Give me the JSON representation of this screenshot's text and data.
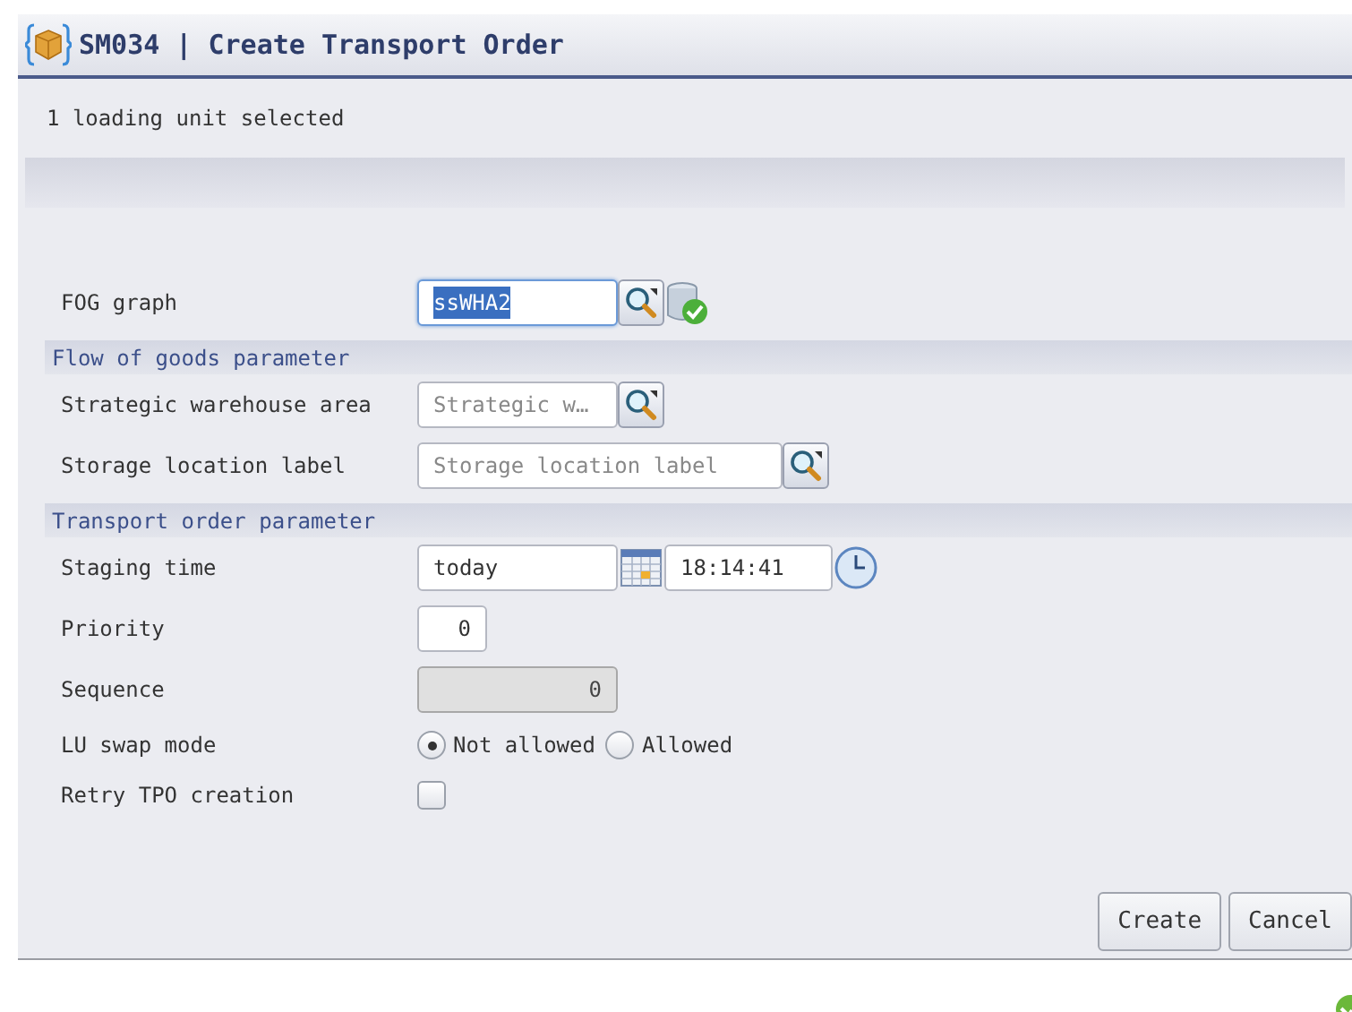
{
  "window": {
    "title": "SM034 | Create Transport Order"
  },
  "info": "1 loading unit selected",
  "rows": [
    {
      "kind": "field",
      "label": "FOG graph",
      "value": "ssWHA2",
      "focused": true,
      "validated": true
    },
    {
      "kind": "section",
      "label": "Flow of goods parameter"
    },
    {
      "kind": "field",
      "label": "Strategic warehouse area",
      "placeholder": "Strategic w…"
    },
    {
      "kind": "field",
      "label": "Storage location label",
      "placeholder": "Storage location label"
    },
    {
      "kind": "section",
      "label": "Transport order parameter"
    },
    {
      "kind": "datetime",
      "label": "Staging time",
      "date": "today",
      "time": "18:14:41"
    },
    {
      "kind": "number",
      "label": "Priority",
      "value": "0",
      "disabled": false
    },
    {
      "kind": "number",
      "label": "Sequence",
      "value": "0",
      "disabled": true
    },
    {
      "kind": "radio",
      "label": "LU swap mode",
      "options": [
        {
          "label": "Not allowed",
          "selected": true
        },
        {
          "label": "Allowed",
          "selected": false
        }
      ]
    },
    {
      "kind": "checkbox",
      "label": "Retry TPO creation",
      "checked": false
    }
  ],
  "buttons": [
    "Create",
    "Cancel"
  ]
}
